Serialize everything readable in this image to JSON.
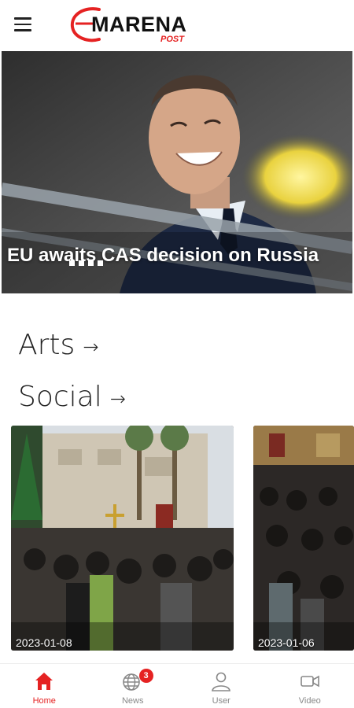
{
  "header": {
    "logo_main": "MARENA",
    "logo_sub": "POST"
  },
  "hero": {
    "title": "EU awaits CAS decision on Russia"
  },
  "sections": [
    {
      "label": "Arts",
      "arrow": "→"
    },
    {
      "label": "Social",
      "arrow": "→"
    }
  ],
  "cards": [
    {
      "date": "2023-01-08"
    },
    {
      "date": "2023-01-06"
    }
  ],
  "bottom_nav": {
    "items": [
      {
        "label": "Home",
        "icon": "home-icon",
        "active": true
      },
      {
        "label": "News",
        "icon": "globe-icon",
        "badge": "3"
      },
      {
        "label": "User",
        "icon": "user-icon"
      },
      {
        "label": "Video",
        "icon": "video-icon"
      }
    ],
    "accent": "#e52222"
  }
}
